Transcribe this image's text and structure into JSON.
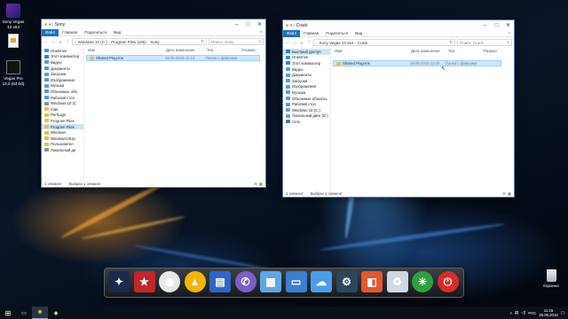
{
  "desktop_icons": [
    {
      "label_lines": [
        "Sony Vegas",
        "13 x64"
      ],
      "icon": "sony-vegas-icon"
    },
    {
      "label_lines": [
        "Vegas Pro",
        "13.0 (64-bit)"
      ],
      "icon": "vegas-pro-icon"
    },
    {
      "label_lines": [
        "Корзина"
      ],
      "icon": "recycle-bin-icon"
    }
  ],
  "window_left": {
    "title": "Sony",
    "ribbon_tabs": [
      "Файл",
      "Главная",
      "Поделиться",
      "Вид"
    ],
    "breadcrumb": [
      "Windows 10 (C:)",
      "Program Files (x86)",
      "Sony"
    ],
    "search_placeholder": "Поиск: Sony",
    "columns": [
      "Имя",
      "Дата изменения",
      "Тип",
      "Размер"
    ],
    "nav_items": [
      {
        "label": "OneDrive",
        "icon": "onedrive-icon"
      },
      {
        "label": "Этот компьютер",
        "icon": "computer-icon"
      },
      {
        "label": "Видео",
        "icon": "video-folder-icon"
      },
      {
        "label": "Документы",
        "icon": "documents-folder-icon"
      },
      {
        "label": "Загрузки",
        "icon": "downloads-folder-icon"
      },
      {
        "label": "Изображения",
        "icon": "pictures-folder-icon"
      },
      {
        "label": "Музыка",
        "icon": "music-folder-icon"
      },
      {
        "label": "Объемные объ",
        "icon": "3d-objects-folder-icon"
      },
      {
        "label": "Рабочий стол",
        "icon": "desktop-folder-icon"
      },
      {
        "label": "Windows 10 (C",
        "icon": "drive-icon"
      },
      {
        "label": "Intel",
        "icon": "folder-icon"
      },
      {
        "label": "PerfLogs",
        "icon": "folder-icon"
      },
      {
        "label": "Program Files",
        "icon": "folder-icon"
      },
      {
        "label": "Program Files",
        "icon": "folder-icon",
        "selected": true
      },
      {
        "label": "Windows",
        "icon": "folder-icon"
      },
      {
        "label": "Windows10Up",
        "icon": "folder-icon"
      },
      {
        "label": "Пользовател",
        "icon": "folder-icon"
      },
      {
        "label": "Локальный ди",
        "icon": "drive-icon"
      }
    ],
    "files": [
      {
        "name": "Shared Plug-Ins",
        "date": "28.05.2018 11:13",
        "type": "Папка с файлами",
        "selected": true
      }
    ],
    "status_count": "1 элемент",
    "status_selected": "Выбран 1 элемент"
  },
  "window_right": {
    "title": "Crack",
    "ribbon_tabs": [
      "Файл",
      "Главная",
      "Поделиться",
      "Вид"
    ],
    "breadcrumb": [
      "Sony Vegas 13 x64",
      "Crack"
    ],
    "search_placeholder": "Поиск: Crack",
    "columns": [
      "Имя",
      "Дата изменения",
      "Тип",
      "Размер"
    ],
    "nav_items": [
      {
        "label": "Быстрый доступ",
        "icon": "quick-access-icon",
        "selected": true
      },
      {
        "label": "OneDrive",
        "icon": "onedrive-icon"
      },
      {
        "label": "Этот компьютер",
        "icon": "computer-icon"
      },
      {
        "label": "Видео",
        "icon": "video-folder-icon"
      },
      {
        "label": "Документы",
        "icon": "documents-folder-icon"
      },
      {
        "label": "Загрузки",
        "icon": "downloads-folder-icon"
      },
      {
        "label": "Изображения",
        "icon": "pictures-folder-icon"
      },
      {
        "label": "Музыка",
        "icon": "music-folder-icon"
      },
      {
        "label": "Объемные объекты",
        "icon": "3d-objects-folder-icon"
      },
      {
        "label": "Рабочий стол",
        "icon": "desktop-folder-icon"
      },
      {
        "label": "Windows 10 (C:)",
        "icon": "drive-icon"
      },
      {
        "label": "Локальный диск (D:)",
        "icon": "drive-icon"
      },
      {
        "label": "Сеть",
        "icon": "network-icon"
      }
    ],
    "files": [
      {
        "name": "Shared Plug-Ins",
        "date": "28.05.2018 11:00",
        "type": "Папка с файлами",
        "selected": true
      }
    ],
    "status_count": "1 элемент",
    "status_selected": "Выбран 1 элемент"
  },
  "dock_apps": [
    {
      "name": "network-app-icon",
      "color": "#1b2a4a",
      "glyph": "✦"
    },
    {
      "name": "pokerstars-icon",
      "color": "#c0262c",
      "glyph": "★"
    },
    {
      "name": "chrome-icon",
      "color": "#e8e8e8",
      "glyph": "◉"
    },
    {
      "name": "aimp-icon",
      "color": "#f2b705",
      "glyph": "▲"
    },
    {
      "name": "save-disk-icon",
      "color": "#2f64c8",
      "glyph": "▤"
    },
    {
      "name": "viber-icon",
      "color": "#7b5fc4",
      "glyph": "✆"
    },
    {
      "name": "image-viewer-icon",
      "color": "#5fa7e0",
      "glyph": "▦"
    },
    {
      "name": "monitor-icon",
      "color": "#3b7fd0",
      "glyph": "▭"
    },
    {
      "name": "cloud-icon",
      "color": "#4c9de8",
      "glyph": "☁"
    },
    {
      "name": "steam-icon",
      "color": "#2a475e",
      "glyph": "⚙"
    },
    {
      "name": "office-icon",
      "color": "#e4572e",
      "glyph": "◧"
    },
    {
      "name": "recycle-icon",
      "color": "#cfd8e3",
      "glyph": "♻"
    },
    {
      "name": "power-green-icon",
      "color": "#2ea043",
      "glyph": "✳"
    },
    {
      "name": "power-red-icon",
      "color": "#d62b2b",
      "glyph": "⏻"
    }
  ],
  "taskbar": {
    "language": "РУС",
    "time": "11:15",
    "date": "28.05.2018"
  }
}
